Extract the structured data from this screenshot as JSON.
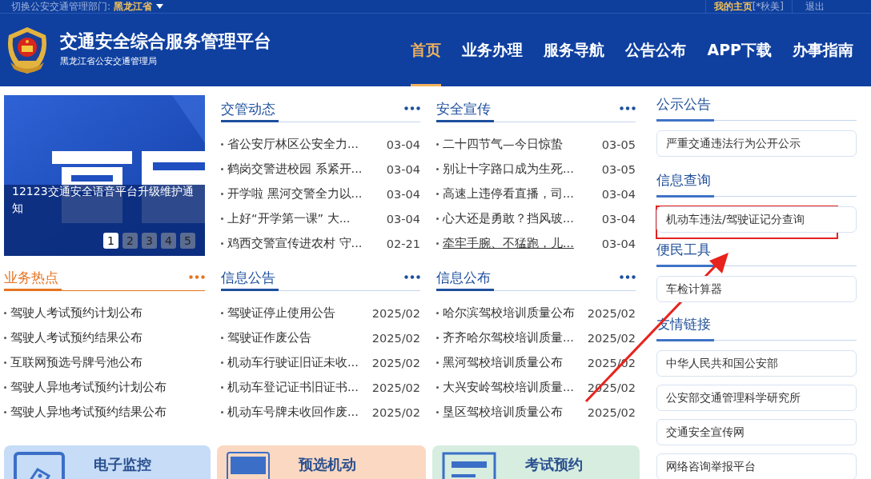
{
  "top_bar": {
    "switch_label": "切换公安交通管理部门:",
    "region": "黑龙江省",
    "home_link": "我的主页",
    "user": "[*秋美]",
    "logout": "退出"
  },
  "header": {
    "title": "交通安全综合服务管理平台",
    "subtitle": "黑龙江省公安交通管理局"
  },
  "nav": [
    {
      "label": "首页",
      "selected": true
    },
    {
      "label": "业务办理",
      "selected": false
    },
    {
      "label": "服务导航",
      "selected": false
    },
    {
      "label": "公告公布",
      "selected": false
    },
    {
      "label": "APP下载",
      "selected": false
    },
    {
      "label": "办事指南",
      "selected": false
    }
  ],
  "carousel": {
    "caption": "12123交通安全语音平台升级维护通知",
    "pages": [
      {
        "label": "1",
        "selected": true
      },
      {
        "label": "2",
        "selected": false
      },
      {
        "label": "3",
        "selected": false
      },
      {
        "label": "4",
        "selected": false
      },
      {
        "label": "5",
        "selected": false
      }
    ]
  },
  "sections": [
    {
      "title": "交管动态",
      "kind": "news",
      "items": [
        {
          "text": "省公安厅林区公安全力...",
          "date": "03-04",
          "hovered": false
        },
        {
          "text": "鹤岗交警进校园 系紧开...",
          "date": "03-04",
          "hovered": false
        },
        {
          "text": "开学啦 黑河交警全力以...",
          "date": "03-04",
          "hovered": false
        },
        {
          "text": "上好“开学第一课” 大...",
          "date": "03-04",
          "hovered": false
        },
        {
          "text": "鸡西交警宣传进农村 守...",
          "date": "02-21",
          "hovered": false
        }
      ]
    },
    {
      "title": "安全宣传",
      "kind": "news",
      "items": [
        {
          "text": "二十四节气—今日惊蛰",
          "date": "03-05",
          "hovered": false
        },
        {
          "text": "别让十字路口成为生死...",
          "date": "03-05",
          "hovered": false
        },
        {
          "text": "高速上违停看直播，司...",
          "date": "03-04",
          "hovered": false
        },
        {
          "text": "心大还是勇敢？挡风玻...",
          "date": "03-04",
          "hovered": false
        },
        {
          "text": "牵牢手腕、不猛跑，儿...",
          "date": "03-04",
          "hovered": true
        }
      ]
    },
    {
      "title": "业务热点",
      "kind": "hot",
      "items": [
        {
          "text": "驾驶人考试预约计划公布",
          "hovered": false
        },
        {
          "text": "驾驶人考试预约结果公布",
          "hovered": false
        },
        {
          "text": "互联网预选号牌号池公布",
          "hovered": false
        },
        {
          "text": "驾驶人异地考试预约计划公布",
          "hovered": false
        },
        {
          "text": "驾驶人异地考试预约结果公布",
          "hovered": false
        }
      ]
    },
    {
      "title": "信息公告",
      "kind": "news",
      "items": [
        {
          "text": "驾驶证停止使用公告",
          "date": "2025/02",
          "hovered": false
        },
        {
          "text": "驾驶证作废公告",
          "date": "2025/02",
          "hovered": false
        },
        {
          "text": "机动车行驶证旧证未收...",
          "date": "2025/02",
          "hovered": false
        },
        {
          "text": "机动车登记证书旧证书...",
          "date": "2025/02",
          "hovered": false
        },
        {
          "text": "机动车号牌未收回作废...",
          "date": "2025/02",
          "hovered": false
        }
      ]
    },
    {
      "title": "信息公布",
      "kind": "news",
      "items": [
        {
          "text": "哈尔滨驾校培训质量公布",
          "date": "2025/02",
          "hovered": false
        },
        {
          "text": "齐齐哈尔驾校培训质量...",
          "date": "2025/02",
          "hovered": false
        },
        {
          "text": "黑河驾校培训质量公布",
          "date": "2025/02",
          "hovered": false
        },
        {
          "text": "大兴安岭驾校培训质量...",
          "date": "2025/02",
          "hovered": false
        },
        {
          "text": "垦区驾校培训质量公布",
          "date": "2025/02",
          "hovered": false
        }
      ]
    }
  ],
  "side_panels": [
    {
      "title": "公示公告",
      "links": [
        {
          "text": "严重交通违法行为公开公示",
          "highlighted": false
        }
      ]
    },
    {
      "title": "信息查询",
      "links": [
        {
          "text": "机动车违法/驾驶证记分查询",
          "highlighted": true
        }
      ]
    },
    {
      "title": "便民工具",
      "links": [
        {
          "text": "车检计算器",
          "highlighted": false
        }
      ]
    },
    {
      "title": "友情链接",
      "links": [
        {
          "text": "中华人民共和国公安部",
          "highlighted": false
        },
        {
          "text": "公安部交通管理科学研究所",
          "highlighted": false
        },
        {
          "text": "交通安全宣传网",
          "highlighted": false
        },
        {
          "text": "网络咨询举报平台",
          "highlighted": false
        }
      ]
    }
  ],
  "feature_cards": [
    {
      "title": "电子监控",
      "kind": "monitor"
    },
    {
      "title": "预选机动",
      "kind": "plate"
    },
    {
      "title": "考试预约",
      "kind": "exam"
    }
  ]
}
